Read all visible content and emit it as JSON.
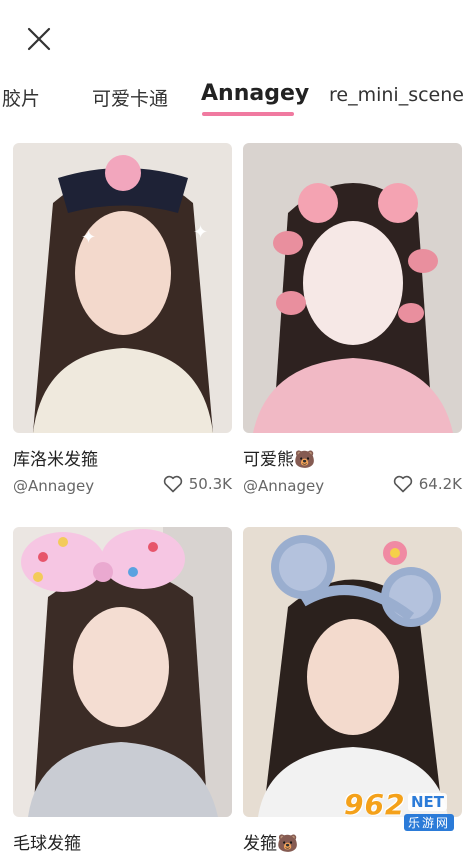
{
  "header": {
    "close_icon": "close-icon"
  },
  "tabs": [
    {
      "label": "胶片",
      "active": false
    },
    {
      "label": "可爱卡通",
      "active": false
    },
    {
      "label": "Annagey",
      "active": true
    },
    {
      "label": "re_mini_scene",
      "active": false
    }
  ],
  "cards": [
    {
      "title": "库洛米发箍",
      "author": "@Annagey",
      "likes": "50.3K"
    },
    {
      "title": "可爱熊🐻",
      "author": "@Annagey",
      "likes": "64.2K"
    },
    {
      "title": "毛球发箍",
      "author": "",
      "likes": ""
    },
    {
      "title": "发箍🐻",
      "author": "",
      "likes": ""
    }
  ],
  "watermark": {
    "number": "962",
    "suffix": "NET",
    "text": "乐游网"
  },
  "colors": {
    "accent": "#f07aa0",
    "text": "#222222",
    "muted": "#666666"
  }
}
